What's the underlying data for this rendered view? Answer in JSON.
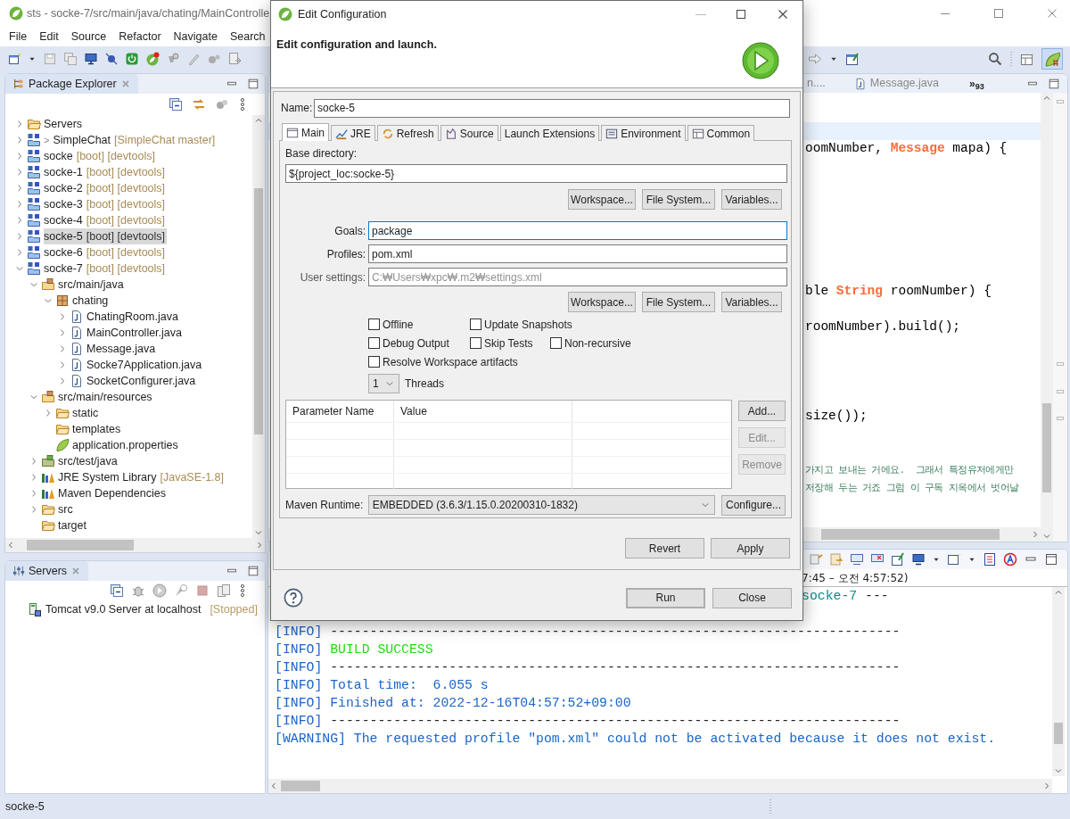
{
  "window": {
    "title": "sts - socke-7/src/main/java/chating/MainControlle"
  },
  "menu": [
    "File",
    "Edit",
    "Source",
    "Refactor",
    "Navigate",
    "Search"
  ],
  "package_explorer": {
    "title": "Package Explorer",
    "tree": [
      {
        "label": "Servers",
        "kind": "folder",
        "expanded": false,
        "selected": false
      },
      {
        "label": "SimpleChat",
        "marker": ">",
        "decoration": "[SimpleChat master]",
        "kind": "project",
        "expanded": false,
        "selected": false
      },
      {
        "label": "socke",
        "decoration": "[boot] [devtools]",
        "kind": "project",
        "expanded": false,
        "selected": false
      },
      {
        "label": "socke-1",
        "decoration": "[boot] [devtools]",
        "kind": "project",
        "expanded": false,
        "selected": false
      },
      {
        "label": "socke-2",
        "decoration": "[boot] [devtools]",
        "kind": "project",
        "expanded": false,
        "selected": false
      },
      {
        "label": "socke-3",
        "decoration": "[boot] [devtools]",
        "kind": "project",
        "expanded": false,
        "selected": false
      },
      {
        "label": "socke-4",
        "decoration": "[boot] [devtools]",
        "kind": "project",
        "expanded": false,
        "selected": false
      },
      {
        "label": "socke-5",
        "decoration": "[boot] [devtools]",
        "kind": "project",
        "expanded": false,
        "selected": true
      },
      {
        "label": "socke-6",
        "decoration": "[boot] [devtools]",
        "kind": "project",
        "expanded": false,
        "selected": false
      },
      {
        "label": "socke-7",
        "decoration": "[boot] [devtools]",
        "kind": "project",
        "expanded": true,
        "selected": false,
        "children": [
          {
            "label": "src/main/java",
            "kind": "sourcefolder",
            "expanded": true,
            "selected": false,
            "children": [
              {
                "label": "chating",
                "kind": "package",
                "expanded": true,
                "selected": false,
                "children": [
                  {
                    "label": "ChatingRoom.java",
                    "kind": "javafile",
                    "expanded": false,
                    "selected": false
                  },
                  {
                    "label": "MainController.java",
                    "kind": "javafile",
                    "expanded": false,
                    "selected": false
                  },
                  {
                    "label": "Message.java",
                    "kind": "javafile",
                    "expanded": false,
                    "selected": false
                  },
                  {
                    "label": "Socke7Application.java",
                    "kind": "javafile",
                    "expanded": false,
                    "selected": false
                  },
                  {
                    "label": "SocketConfigurer.java",
                    "kind": "javafile",
                    "expanded": false,
                    "selected": false
                  }
                ]
              }
            ]
          },
          {
            "label": "src/main/resources",
            "kind": "sourcefolder",
            "expanded": true,
            "selected": false,
            "children": [
              {
                "label": "static",
                "kind": "folder",
                "expanded": false,
                "selected": false
              },
              {
                "label": "templates",
                "kind": "folder",
                "selected": false
              },
              {
                "label": "application.properties",
                "kind": "properties",
                "selected": false
              }
            ]
          },
          {
            "label": "src/test/java",
            "kind": "testfolder",
            "expanded": false,
            "selected": false
          },
          {
            "label": "JRE System Library",
            "decoration": "[JavaSE-1.8]",
            "kind": "library",
            "expanded": false,
            "selected": false
          },
          {
            "label": "Maven Dependencies",
            "kind": "library",
            "expanded": false,
            "selected": false
          },
          {
            "label": "src",
            "kind": "folder",
            "expanded": false,
            "selected": false
          },
          {
            "label": "target",
            "kind": "folder",
            "selected": false
          }
        ]
      }
    ]
  },
  "servers": {
    "title": "Servers",
    "items": [
      {
        "label": "Tomcat v9.0 Server at localhost",
        "status": "[Stopped]"
      }
    ]
  },
  "editor": {
    "tabs": [
      {
        "label": "n....",
        "selected": false
      },
      {
        "label": "Message.java",
        "selected": false
      }
    ],
    "overflow": "»$_{93}$",
    "lines": [
      {
        "kind": "blank",
        "current": true
      },
      {
        "kind": "code",
        "current": false,
        "segments": [
          {
            "text": "oomNumber, ",
            "kind": "plain"
          },
          {
            "text": "Message",
            "kind": "type"
          },
          {
            "text": " mapa) {",
            "kind": "plain"
          }
        ]
      },
      {
        "kind": "blank",
        "current": false
      },
      {
        "kind": "blank",
        "current": false
      },
      {
        "kind": "blank",
        "current": false
      },
      {
        "kind": "blank",
        "current": false
      },
      {
        "kind": "blank",
        "current": false
      },
      {
        "kind": "blank",
        "current": false
      },
      {
        "kind": "blank",
        "current": false
      },
      {
        "kind": "code",
        "current": false,
        "segments": [
          {
            "text": "ble ",
            "kind": "plain"
          },
          {
            "text": "String",
            "kind": "type"
          },
          {
            "text": " roomNumber) {",
            "kind": "plain"
          }
        ]
      },
      {
        "kind": "blank",
        "current": false
      },
      {
        "kind": "code",
        "current": false,
        "segments": [
          {
            "text": "roomNumber).build();",
            "kind": "plain"
          }
        ]
      },
      {
        "kind": "blank",
        "current": false
      },
      {
        "kind": "blank",
        "current": false
      },
      {
        "kind": "blank",
        "current": false
      },
      {
        "kind": "blank",
        "current": false
      },
      {
        "kind": "code",
        "current": false,
        "segments": [
          {
            "text": "size());",
            "kind": "plain"
          }
        ]
      },
      {
        "kind": "blank",
        "current": false
      },
      {
        "kind": "blank",
        "current": false
      },
      {
        "kind": "code",
        "current": false,
        "segments": [
          {
            "text": "가지고 보내는 거에요.  그래서 특정유저에게만",
            "kind": "comment"
          }
        ]
      },
      {
        "kind": "code",
        "current": false,
        "segments": [
          {
            "text": "저장해 두는 거죠 그럼 이 구독 지옥에서 벗어날",
            "kind": "comment"
          }
        ]
      }
    ]
  },
  "console": {
    "header": "7:45 – 오전 4:57:52)",
    "lines": [
      {
        "kind": "clipped",
        "segments": [
          {
            "text": "socke-7",
            "kind": "project"
          },
          {
            "text": " ---",
            "kind": "plain"
          }
        ]
      },
      {
        "kind": "full",
        "segments": [
          {
            "text": "[INFO]",
            "kind": "info"
          },
          {
            "text": " ------------------------------------------------------------------------",
            "kind": "plain"
          }
        ]
      },
      {
        "kind": "full",
        "segments": [
          {
            "text": "[INFO]",
            "kind": "info"
          },
          {
            "text": " BUILD SUCCESS",
            "kind": "success"
          }
        ]
      },
      {
        "kind": "full",
        "segments": [
          {
            "text": "[INFO]",
            "kind": "info"
          },
          {
            "text": " ------------------------------------------------------------------------",
            "kind": "plain"
          }
        ]
      },
      {
        "kind": "full",
        "segments": [
          {
            "text": "[INFO] Total time:  6.055 s",
            "kind": "info"
          }
        ]
      },
      {
        "kind": "full",
        "segments": [
          {
            "text": "[INFO] Finished at: 2022-12-16T04:57:52+09:00",
            "kind": "info"
          }
        ]
      },
      {
        "kind": "full",
        "segments": [
          {
            "text": "[INFO]",
            "kind": "info"
          },
          {
            "text": " ------------------------------------------------------------------------",
            "kind": "plain"
          }
        ]
      },
      {
        "kind": "full",
        "segments": [
          {
            "text": "[WARNING] The requested profile \"pom.xml\" could not be activated because it does not exist.",
            "kind": "info"
          }
        ]
      }
    ]
  },
  "status_bar": {
    "text": "socke-5"
  },
  "dialog": {
    "title": "Edit Configuration",
    "heading": "Edit configuration and launch.",
    "name_label": "Name:",
    "name": "socke-5",
    "tabs": [
      {
        "label": "Main",
        "kind": "main",
        "selected": true
      },
      {
        "label": "JRE",
        "kind": "jre",
        "selected": false
      },
      {
        "label": "Refresh",
        "kind": "refresh",
        "selected": false
      },
      {
        "label": "Source",
        "kind": "source",
        "selected": false
      },
      {
        "label": "Launch Extensions",
        "kind": "plain",
        "selected": false
      },
      {
        "label": "Environment",
        "kind": "environment",
        "selected": false
      },
      {
        "label": "Common",
        "kind": "common",
        "selected": false
      }
    ],
    "base_directory": {
      "label": "Base directory:",
      "value": "${project_loc:socke-5}",
      "buttons": [
        "Workspace...",
        "File System...",
        "Variables..."
      ]
    },
    "fields": [
      {
        "label": "Goals:",
        "value": "package",
        "focused": true
      },
      {
        "label": "Profiles:",
        "value": "pom.xml",
        "focused": false
      },
      {
        "label": "User settings:",
        "placeholder": "C:₩Users₩xpc₩.m2₩settings.xml",
        "focused": false
      }
    ],
    "settings_buttons": [
      "Workspace...",
      "File System...",
      "Variables..."
    ],
    "options": [
      [
        {
          "label": "Offline",
          "checked": false
        },
        {
          "label": "Update Snapshots",
          "checked": false
        }
      ],
      [
        {
          "label": "Debug Output",
          "checked": false
        },
        {
          "label": "Skip Tests",
          "checked": false
        },
        {
          "label": "Non-recursive",
          "checked": false
        }
      ],
      [
        {
          "label": "Resolve Workspace artifacts",
          "checked": false
        }
      ]
    ],
    "threads": {
      "value": "1",
      "label": "Threads"
    },
    "parameters": {
      "columns": [
        "Parameter Name",
        "Value"
      ],
      "buttons": [
        {
          "label": "Add...",
          "disabled": false
        },
        {
          "label": "Edit...",
          "disabled": true
        },
        {
          "label": "Remove",
          "disabled": true
        }
      ]
    },
    "maven_runtime": {
      "label": "Maven Runtime:",
      "value": "EMBEDDED (3.6.3/1.15.0.20200310-1832)",
      "button": "Configure..."
    },
    "actions": [
      "Revert",
      "Apply"
    ],
    "footer": [
      {
        "label": "Run",
        "default": true
      },
      {
        "label": "Close",
        "default": false
      }
    ]
  }
}
